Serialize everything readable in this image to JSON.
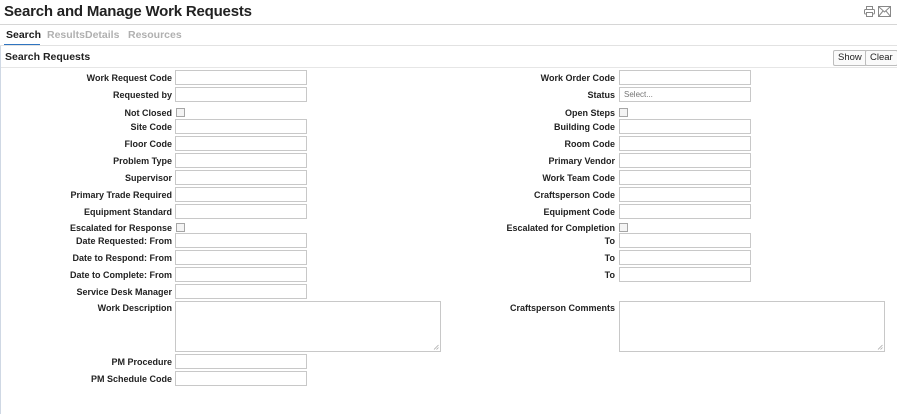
{
  "page": {
    "title": "Search and Manage Work Requests",
    "icons": [
      "print-icon",
      "email-icon"
    ]
  },
  "tabs": [
    {
      "label": "Search",
      "active": true
    },
    {
      "label": "Results",
      "active": false
    },
    {
      "label": "Details",
      "active": false
    },
    {
      "label": "Resources",
      "active": false
    }
  ],
  "section": {
    "title": "Search Requests",
    "show_label": "Show",
    "clear_label": "Clear"
  },
  "form": {
    "left": {
      "work_request_code": "Work Request Code",
      "requested_by": "Requested by",
      "not_closed": "Not Closed",
      "site_code": "Site Code",
      "floor_code": "Floor Code",
      "problem_type": "Problem Type",
      "supervisor": "Supervisor",
      "primary_trade_required": "Primary Trade Required",
      "equipment_standard": "Equipment Standard",
      "escalated_for_response": "Escalated for Response",
      "date_requested_from": "Date Requested: From",
      "date_to_respond_from": "Date to Respond: From",
      "date_to_complete_from": "Date to Complete: From",
      "service_desk_manager": "Service Desk Manager",
      "work_description": "Work Description",
      "pm_procedure": "PM Procedure",
      "pm_schedule_code": "PM Schedule Code"
    },
    "right": {
      "work_order_code": "Work Order Code",
      "status": "Status",
      "status_placeholder": "Select...",
      "open_steps": "Open Steps",
      "building_code": "Building Code",
      "room_code": "Room Code",
      "primary_vendor": "Primary Vendor",
      "work_team_code": "Work Team Code",
      "craftsperson_code": "Craftsperson Code",
      "equipment_code": "Equipment Code",
      "escalated_for_completion": "Escalated for Completion",
      "to_1": "To",
      "to_2": "To",
      "to_3": "To",
      "craftsperson_comments": "Craftsperson Comments"
    }
  }
}
